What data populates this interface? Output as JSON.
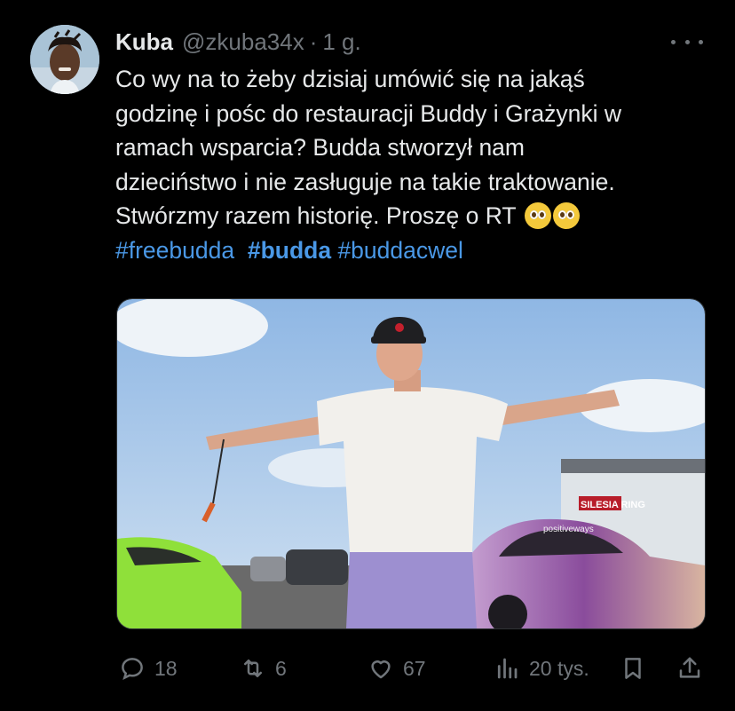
{
  "tweet": {
    "author_name": "Kuba",
    "handle": "@zkuba34x",
    "separator": "·",
    "time": "1 g.",
    "text_lines": [
      "Co wy na to żeby dzisiaj umówić się na jakąś",
      "godzinę i pośc do restauracji Buddy i Grażynki w",
      "ramach wsparcia? Budda stworzył nam",
      "dzieciństwo i nie zasługuje na takie traktowanie.",
      "Stwórzmy razem historię. Proszę o RT"
    ],
    "hashtags": [
      "#freebudda",
      "#budda",
      "#buddacwel"
    ]
  },
  "media": {
    "image_text": [
      "positiveways",
      "SILESIA RING"
    ]
  },
  "actions": {
    "replies": "18",
    "retweets": "6",
    "likes": "67",
    "views": "20 tys."
  },
  "icons": [
    "avatar",
    "more-icon",
    "reply-icon",
    "retweet-icon",
    "like-icon",
    "views-icon",
    "bookmark-icon",
    "share-icon"
  ],
  "colors": {
    "background": "#000000",
    "text": "#e7e9ea",
    "muted": "#71767b",
    "hashtag": "#4a98e6"
  }
}
